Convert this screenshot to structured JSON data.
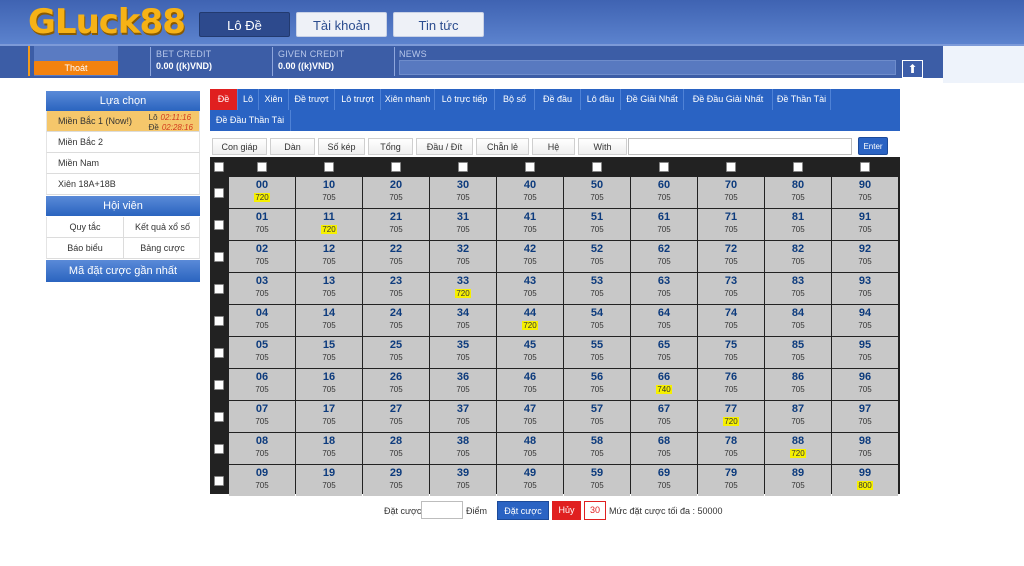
{
  "brand": {
    "logo": "GLuck88"
  },
  "topnav": [
    "Lô Đề",
    "Tài khoản",
    "Tin tức"
  ],
  "account": {
    "logout": "Thoát",
    "bet_credit_label": "BET CREDIT",
    "bet_credit_value": "0.00 ((k)VND)",
    "given_credit_label": "GIVEN CREDIT",
    "given_credit_value": "0.00 ((k)VND)",
    "news_label": "NEWS"
  },
  "sidebar": {
    "select_title": "Lựa chọn",
    "regions": [
      {
        "label": "Miền Bắc 1 (Now!)",
        "lo_label": "Lô",
        "lo_time": "02:11:16",
        "de_label": "Đề",
        "de_time": "02:28:16"
      },
      {
        "label": "Miền Bắc 2"
      },
      {
        "label": "Miền Nam"
      },
      {
        "label": "Xiên 18A+18B"
      }
    ],
    "member_title": "Hội viên",
    "member_links": [
      "Quy tắc",
      "Kết quả xổ số",
      "Báo biểu",
      "Bảng cược"
    ],
    "recent_title": "Mã đặt cược gần nhất"
  },
  "tabs": [
    "Đề",
    "Lô",
    "Xiên",
    "Đề trượt",
    "Lô trượt",
    "Xiên nhanh",
    "Lô trực tiếp",
    "Bộ số",
    "Đề đầu",
    "Lô đầu",
    "Đề Giải Nhất",
    "Đề Đầu Giải Nhất",
    "Đề Thần Tài",
    "Đề Đầu Thần Tài"
  ],
  "filters": [
    "Con giáp",
    "Dàn",
    "Số kép",
    "Tổng",
    "Đầu / Đít",
    "Chẵn lẻ",
    "Hệ",
    "With"
  ],
  "enter_label": "Enter",
  "grid": {
    "default_value": "705",
    "rows": [
      [
        [
          "00",
          "720"
        ],
        [
          "10",
          "705"
        ],
        [
          "20",
          "705"
        ],
        [
          "30",
          "705"
        ],
        [
          "40",
          "705"
        ],
        [
          "50",
          "705"
        ],
        [
          "60",
          "705"
        ],
        [
          "70",
          "705"
        ],
        [
          "80",
          "705"
        ],
        [
          "90",
          "705"
        ]
      ],
      [
        [
          "01",
          "705"
        ],
        [
          "11",
          "720"
        ],
        [
          "21",
          "705"
        ],
        [
          "31",
          "705"
        ],
        [
          "41",
          "705"
        ],
        [
          "51",
          "705"
        ],
        [
          "61",
          "705"
        ],
        [
          "71",
          "705"
        ],
        [
          "81",
          "705"
        ],
        [
          "91",
          "705"
        ]
      ],
      [
        [
          "02",
          "705"
        ],
        [
          "12",
          "705"
        ],
        [
          "22",
          "705"
        ],
        [
          "32",
          "705"
        ],
        [
          "42",
          "705"
        ],
        [
          "52",
          "705"
        ],
        [
          "62",
          "705"
        ],
        [
          "72",
          "705"
        ],
        [
          "82",
          "705"
        ],
        [
          "92",
          "705"
        ]
      ],
      [
        [
          "03",
          "705"
        ],
        [
          "13",
          "705"
        ],
        [
          "23",
          "705"
        ],
        [
          "33",
          "720"
        ],
        [
          "43",
          "705"
        ],
        [
          "53",
          "705"
        ],
        [
          "63",
          "705"
        ],
        [
          "73",
          "705"
        ],
        [
          "83",
          "705"
        ],
        [
          "93",
          "705"
        ]
      ],
      [
        [
          "04",
          "705"
        ],
        [
          "14",
          "705"
        ],
        [
          "24",
          "705"
        ],
        [
          "34",
          "705"
        ],
        [
          "44",
          "720"
        ],
        [
          "54",
          "705"
        ],
        [
          "64",
          "705"
        ],
        [
          "74",
          "705"
        ],
        [
          "84",
          "705"
        ],
        [
          "94",
          "705"
        ]
      ],
      [
        [
          "05",
          "705"
        ],
        [
          "15",
          "705"
        ],
        [
          "25",
          "705"
        ],
        [
          "35",
          "705"
        ],
        [
          "45",
          "705"
        ],
        [
          "55",
          "705"
        ],
        [
          "65",
          "705"
        ],
        [
          "75",
          "705"
        ],
        [
          "85",
          "705"
        ],
        [
          "95",
          "705"
        ]
      ],
      [
        [
          "06",
          "705"
        ],
        [
          "16",
          "705"
        ],
        [
          "26",
          "705"
        ],
        [
          "36",
          "705"
        ],
        [
          "46",
          "705"
        ],
        [
          "56",
          "705"
        ],
        [
          "66",
          "740"
        ],
        [
          "76",
          "705"
        ],
        [
          "86",
          "705"
        ],
        [
          "96",
          "705"
        ]
      ],
      [
        [
          "07",
          "705"
        ],
        [
          "17",
          "705"
        ],
        [
          "27",
          "705"
        ],
        [
          "37",
          "705"
        ],
        [
          "47",
          "705"
        ],
        [
          "57",
          "705"
        ],
        [
          "67",
          "705"
        ],
        [
          "77",
          "720"
        ],
        [
          "87",
          "705"
        ],
        [
          "97",
          "705"
        ]
      ],
      [
        [
          "08",
          "705"
        ],
        [
          "18",
          "705"
        ],
        [
          "28",
          "705"
        ],
        [
          "38",
          "705"
        ],
        [
          "48",
          "705"
        ],
        [
          "58",
          "705"
        ],
        [
          "68",
          "705"
        ],
        [
          "78",
          "705"
        ],
        [
          "88",
          "720"
        ],
        [
          "98",
          "705"
        ]
      ],
      [
        [
          "09",
          "705"
        ],
        [
          "19",
          "705"
        ],
        [
          "29",
          "705"
        ],
        [
          "39",
          "705"
        ],
        [
          "49",
          "705"
        ],
        [
          "59",
          "705"
        ],
        [
          "69",
          "705"
        ],
        [
          "79",
          "705"
        ],
        [
          "89",
          "705"
        ],
        [
          "99",
          "800"
        ]
      ]
    ]
  },
  "bet": {
    "label": "Đặt cược",
    "unit": "Điểm",
    "submit": "Đặt cược",
    "cancel": "Hủy",
    "count": "30",
    "max_text": "Mức đặt cược tối đa : 50000"
  },
  "colors": {
    "header": "#4a6fbf",
    "accent": "#2a63c3",
    "active_tab": "#e02020",
    "highlight": "#f6f000",
    "logout": "#f2820f"
  }
}
